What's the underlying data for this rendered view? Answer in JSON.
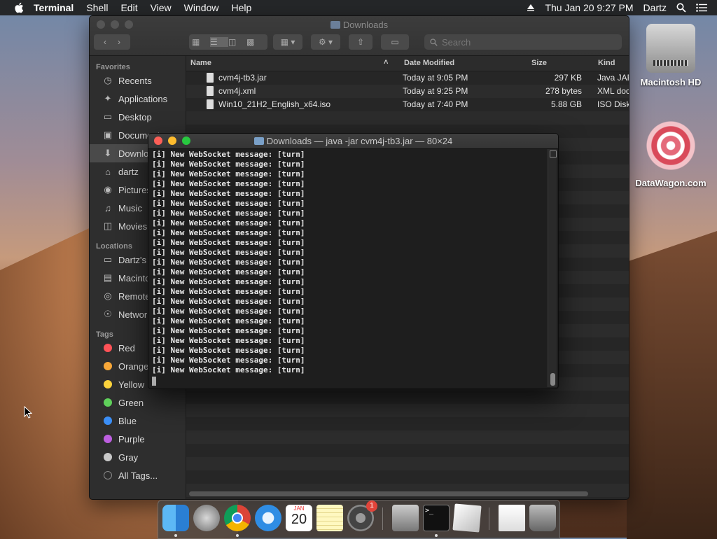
{
  "menubar": {
    "app": "Terminal",
    "items": [
      "Shell",
      "Edit",
      "View",
      "Window",
      "Help"
    ],
    "datetime": "Thu Jan 20  9:27 PM",
    "user": "Dartz"
  },
  "finder": {
    "title": "Downloads",
    "search_placeholder": "Search",
    "sidebar": {
      "favorites_label": "Favorites",
      "favorites": [
        "Recents",
        "Applications",
        "Desktop",
        "Documents",
        "Downloads",
        "dartz",
        "Pictures",
        "Music",
        "Movies"
      ],
      "locations_label": "Locations",
      "locations": [
        "Dartz's",
        "Macintosh",
        "Remote",
        "Network"
      ],
      "tags_label": "Tags",
      "tags": [
        {
          "label": "Red",
          "color": "#ff5257"
        },
        {
          "label": "Orange",
          "color": "#f7a738"
        },
        {
          "label": "Yellow",
          "color": "#fbd33c"
        },
        {
          "label": "Green",
          "color": "#5fd05a"
        },
        {
          "label": "Blue",
          "color": "#3b8ff7"
        },
        {
          "label": "Purple",
          "color": "#bd5fe0"
        },
        {
          "label": "Gray",
          "color": "#c8c8c8"
        }
      ],
      "all_tags": "All Tags..."
    },
    "columns": {
      "name": "Name",
      "date": "Date Modified",
      "size": "Size",
      "kind": "Kind"
    },
    "files": [
      {
        "name": "cvm4j-tb3.jar",
        "date": "Today at 9:05 PM",
        "size": "297 KB",
        "kind": "Java JAR"
      },
      {
        "name": "cvm4j.xml",
        "date": "Today at 9:25 PM",
        "size": "278 bytes",
        "kind": "XML document"
      },
      {
        "name": "Win10_21H2_English_x64.iso",
        "date": "Today at 7:40 PM",
        "size": "5.88 GB",
        "kind": "ISO Disk Image"
      }
    ]
  },
  "terminal": {
    "title": "Downloads — java -jar cvm4j-tb3.jar — 80×24",
    "line_text": "[i] New WebSocket message: [turn]",
    "line_count": 23
  },
  "desktop": {
    "icons": [
      "Macintosh HD",
      "DataWagon.com"
    ]
  },
  "dock": {
    "calendar_month": "JAN",
    "calendar_day": "20",
    "badge": "1"
  },
  "colors": {
    "close": "#fc5f57",
    "minimize": "#fdbc2e",
    "zoom": "#28c840"
  }
}
